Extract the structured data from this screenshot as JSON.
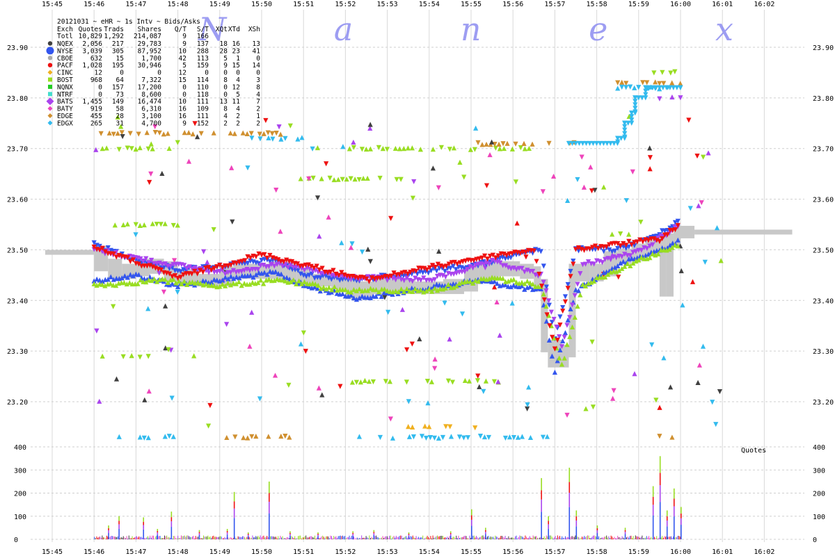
{
  "chart_data": {
    "type": "scatter",
    "title": "20121031 ~ eHR ~ 1s Intv ~ Bids/Asks",
    "watermark": "N a n e x",
    "x_ticks": [
      "15:45",
      "15:46",
      "15:47",
      "15:48",
      "15:49",
      "15:50",
      "15:51",
      "15:52",
      "15:53",
      "15:54",
      "15:55",
      "15:56",
      "15:57",
      "15:58",
      "15:59",
      "16:00",
      "16:01",
      "16:02"
    ],
    "price_axis": {
      "ylim": [
        23.12,
        23.93
      ],
      "ticks": [
        "23.90",
        "23.80",
        "23.70",
        "23.60",
        "23.50",
        "23.40",
        "23.30",
        "23.20"
      ],
      "tick_values": [
        23.9,
        23.8,
        23.7,
        23.6,
        23.5,
        23.4,
        23.3,
        23.2
      ]
    },
    "volume_axis": {
      "label": "Quotes",
      "ylim": [
        0,
        400
      ],
      "ticks": [
        "400",
        "300",
        "200",
        "100",
        "0"
      ],
      "tick_values": [
        400,
        300,
        200,
        100,
        0
      ]
    },
    "legend": {
      "header": [
        "Exch",
        "Quotes",
        "Trads",
        "Shares",
        "Q/T",
        "S/T",
        "XQt",
        "XTd",
        "XSh"
      ],
      "total": [
        "Totl",
        "10,829",
        "1,292",
        "214,087",
        "9",
        "166",
        "",
        "",
        ""
      ],
      "rows": [
        {
          "exch": "NQEX",
          "quotes": "2,056",
          "trads": "217",
          "shares": "29,783",
          "qt": "9",
          "st": "137",
          "xqt": "18",
          "xtd": "16",
          "xsh": "13",
          "color": "#404040",
          "marker": "circle"
        },
        {
          "exch": "NYSE",
          "quotes": "3,039",
          "trads": "305",
          "shares": "87,952",
          "qt": "10",
          "st": "288",
          "xqt": "28",
          "xtd": "23",
          "xsh": "41",
          "color": "#3355ee",
          "marker": "bigcircle"
        },
        {
          "exch": "CBOE",
          "quotes": "632",
          "trads": "15",
          "shares": "1,700",
          "qt": "42",
          "st": "113",
          "xqt": "5",
          "xtd": "1",
          "xsh": "0",
          "color": "#aaaaaa",
          "marker": "circle"
        },
        {
          "exch": "PACF",
          "quotes": "1,028",
          "trads": "195",
          "shares": "30,946",
          "qt": "5",
          "st": "159",
          "xqt": "9",
          "xtd": "15",
          "xsh": "14",
          "color": "#ee1111",
          "marker": "circle"
        },
        {
          "exch": "CINC",
          "quotes": "12",
          "trads": "0",
          "shares": "0",
          "qt": "12",
          "st": "0",
          "xqt": "0",
          "xtd": "0",
          "xsh": "0",
          "color": "#f0b020",
          "marker": "diamond"
        },
        {
          "exch": "BOST",
          "quotes": "968",
          "trads": "64",
          "shares": "7,322",
          "qt": "15",
          "st": "114",
          "xqt": "8",
          "xtd": "4",
          "xsh": "3",
          "color": "#99dd22",
          "marker": "square"
        },
        {
          "exch": "NQNX",
          "quotes": "0",
          "trads": "157",
          "shares": "17,200",
          "qt": "0",
          "st": "110",
          "xqt": "0",
          "xtd": "12",
          "xsh": "8",
          "color": "#22cc22",
          "marker": "square"
        },
        {
          "exch": "NTRF",
          "quotes": "0",
          "trads": "73",
          "shares": "8,600",
          "qt": "0",
          "st": "118",
          "xqt": "0",
          "xtd": "5",
          "xsh": "4",
          "color": "#44ddcc",
          "marker": "square"
        },
        {
          "exch": "BATS",
          "quotes": "1,455",
          "trads": "149",
          "shares": "16,474",
          "qt": "10",
          "st": "111",
          "xqt": "13",
          "xtd": "11",
          "xsh": "7",
          "color": "#aa44ee",
          "marker": "bigdiamond"
        },
        {
          "exch": "BATY",
          "quotes": "919",
          "trads": "58",
          "shares": "6,310",
          "qt": "16",
          "st": "109",
          "xqt": "8",
          "xtd": "4",
          "xsh": "2",
          "color": "#ee44bb",
          "marker": "diamond"
        },
        {
          "exch": "EDGE",
          "quotes": "455",
          "trads": "28",
          "shares": "3,100",
          "qt": "16",
          "st": "111",
          "xqt": "4",
          "xtd": "2",
          "xsh": "1",
          "color": "#d09030",
          "marker": "diamond"
        },
        {
          "exch": "EDGX",
          "quotes": "265",
          "trads": "31",
          "shares": "4,700",
          "qt": "9",
          "st": "152",
          "xqt": "2",
          "xtd": "2",
          "xsh": "2",
          "color": "#33bbee",
          "marker": "diamond"
        }
      ]
    },
    "nbbo_midpoint_path": [
      [
        "15:44:50",
        23.495
      ],
      [
        "15:46:00",
        23.495
      ],
      [
        "15:46:20",
        23.47
      ],
      [
        "15:46:40",
        23.455
      ],
      [
        "15:47:00",
        23.46
      ],
      [
        "15:47:20",
        23.47
      ],
      [
        "15:47:40",
        23.465
      ],
      [
        "15:48:00",
        23.45
      ],
      [
        "15:48:30",
        23.44
      ],
      [
        "15:49:00",
        23.44
      ],
      [
        "15:49:20",
        23.455
      ],
      [
        "15:49:50",
        23.46
      ],
      [
        "15:50:10",
        23.455
      ],
      [
        "15:50:20",
        23.465
      ],
      [
        "15:50:50",
        23.45
      ],
      [
        "15:51:10",
        23.44
      ],
      [
        "15:51:40",
        23.44
      ],
      [
        "15:52:00",
        23.435
      ],
      [
        "15:52:20",
        23.415
      ],
      [
        "15:52:40",
        23.425
      ],
      [
        "15:53:00",
        23.43
      ],
      [
        "15:53:40",
        23.425
      ],
      [
        "15:54:20",
        23.425
      ],
      [
        "15:54:50",
        23.43
      ],
      [
        "15:55:10",
        23.455
      ],
      [
        "15:55:40",
        23.465
      ],
      [
        "15:56:10",
        23.46
      ],
      [
        "15:56:30",
        23.455
      ],
      [
        "15:56:40",
        23.43
      ],
      [
        "15:56:50",
        23.31
      ],
      [
        "15:57:10",
        23.28
      ],
      [
        "15:57:20",
        23.3
      ],
      [
        "15:57:30",
        23.46
      ],
      [
        "15:57:50",
        23.45
      ],
      [
        "15:58:10",
        23.46
      ],
      [
        "15:58:30",
        23.485
      ],
      [
        "15:58:50",
        23.49
      ],
      [
        "15:59:10",
        23.5
      ],
      [
        "15:59:30",
        23.515
      ],
      [
        "15:59:40",
        23.42
      ],
      [
        "15:59:50",
        23.52
      ],
      [
        "16:00:00",
        23.535
      ],
      [
        "16:00:20",
        23.535
      ],
      [
        "16:02:40",
        23.535
      ]
    ],
    "quote_bands": [
      {
        "exch": "NYSE",
        "side": "bid",
        "color": "#3355ee",
        "path": [
          [
            "15:46:00",
            23.44
          ],
          [
            "15:47:00",
            23.45
          ],
          [
            "15:48:00",
            23.43
          ],
          [
            "15:49:20",
            23.445
          ],
          [
            "15:50:20",
            23.455
          ],
          [
            "15:51:00",
            23.43
          ],
          [
            "15:52:20",
            23.405
          ],
          [
            "15:55:10",
            23.44
          ],
          [
            "15:56:40",
            23.42
          ],
          [
            "15:57:00",
            23.26
          ],
          [
            "15:57:30",
            23.42
          ],
          [
            "15:58:30",
            23.47
          ],
          [
            "15:59:30",
            23.5
          ],
          [
            "16:00:00",
            23.52
          ]
        ]
      },
      {
        "exch": "NYSE",
        "side": "ask",
        "color": "#3355ee",
        "path": [
          [
            "15:46:00",
            23.51
          ],
          [
            "15:47:00",
            23.48
          ],
          [
            "15:48:00",
            23.46
          ],
          [
            "15:49:20",
            23.47
          ],
          [
            "15:50:20",
            23.48
          ],
          [
            "15:51:00",
            23.45
          ],
          [
            "15:52:20",
            23.44
          ],
          [
            "15:55:10",
            23.47
          ],
          [
            "15:56:40",
            23.5
          ],
          [
            "15:57:00",
            23.32
          ],
          [
            "15:57:30",
            23.5
          ],
          [
            "15:58:30",
            23.5
          ],
          [
            "15:59:30",
            23.53
          ],
          [
            "16:00:00",
            23.56
          ]
        ]
      },
      {
        "exch": "BOST",
        "side": "bid",
        "color": "#99dd22",
        "path": [
          [
            "15:46:00",
            23.43
          ],
          [
            "15:47:30",
            23.44
          ],
          [
            "15:49:00",
            23.43
          ],
          [
            "15:50:30",
            23.44
          ],
          [
            "15:52:00",
            23.42
          ],
          [
            "15:54:00",
            23.42
          ],
          [
            "15:55:30",
            23.445
          ],
          [
            "15:56:40",
            23.43
          ],
          [
            "15:57:10",
            23.27
          ],
          [
            "15:57:40",
            23.43
          ],
          [
            "15:59:00",
            23.48
          ],
          [
            "16:00:00",
            23.51
          ]
        ]
      },
      {
        "exch": "BATS",
        "side": "ask",
        "color": "#aa44ee",
        "path": [
          [
            "15:46:00",
            23.5
          ],
          [
            "15:47:30",
            23.475
          ],
          [
            "15:49:00",
            23.455
          ],
          [
            "15:50:30",
            23.47
          ],
          [
            "15:52:00",
            23.445
          ],
          [
            "15:54:00",
            23.44
          ],
          [
            "15:55:30",
            23.475
          ],
          [
            "15:56:40",
            23.45
          ],
          [
            "15:57:10",
            23.31
          ],
          [
            "15:57:40",
            23.47
          ],
          [
            "15:59:00",
            23.495
          ],
          [
            "16:00:00",
            23.55
          ]
        ]
      },
      {
        "exch": "PACF",
        "side": "ask",
        "color": "#ee1111",
        "path": [
          [
            "15:46:00",
            23.505
          ],
          [
            "15:48:00",
            23.445
          ],
          [
            "15:50:00",
            23.49
          ],
          [
            "15:52:30",
            23.44
          ],
          [
            "15:55:00",
            23.48
          ],
          [
            "15:56:30",
            23.5
          ],
          [
            "15:57:00",
            23.3
          ],
          [
            "15:57:30",
            23.5
          ],
          [
            "15:59:30",
            23.52
          ],
          [
            "16:00:00",
            23.55
          ]
        ]
      }
    ],
    "sparse_quote_levels": [
      {
        "exch": "BOST",
        "color": "#99dd22",
        "price": 23.7,
        "from": "15:46:00",
        "to": "15:47:50"
      },
      {
        "exch": "EDGE",
        "color": "#d09030",
        "price": 23.73,
        "from": "15:46:10",
        "to": "15:50:50"
      },
      {
        "exch": "EDGX",
        "color": "#33bbee",
        "price": 23.72,
        "from": "15:49:40",
        "to": "15:51:00"
      },
      {
        "exch": "BOST",
        "color": "#99dd22",
        "price": 23.7,
        "from": "15:52:00",
        "to": "15:56:40"
      },
      {
        "exch": "EDGE",
        "color": "#d09030",
        "price": 23.71,
        "from": "15:55:10",
        "to": "15:57:40"
      },
      {
        "exch": "BOST",
        "color": "#99dd22",
        "price": 23.29,
        "from": "15:46:00",
        "to": "15:47:20"
      },
      {
        "exch": "BOST",
        "color": "#99dd22",
        "price": 23.24,
        "from": "15:52:10",
        "to": "15:55:50"
      },
      {
        "exch": "BOST",
        "color": "#99dd22",
        "price": 23.55,
        "from": "15:46:30",
        "to": "15:48:00"
      },
      {
        "exch": "BOST",
        "color": "#99dd22",
        "price": 23.64,
        "from": "15:50:50",
        "to": "15:53:20"
      },
      {
        "exch": "BOST",
        "color": "#99dd22",
        "price": 23.53,
        "from": "15:58:10",
        "to": "15:59:10"
      },
      {
        "exch": "EDGX",
        "color": "#33bbee",
        "price": 23.13,
        "from": "15:46:30",
        "to": "15:48:10"
      },
      {
        "exch": "EDGE",
        "color": "#d09030",
        "price": 23.13,
        "from": "15:49:10",
        "to": "15:50:40"
      },
      {
        "exch": "EDGX",
        "color": "#33bbee",
        "price": 23.13,
        "from": "15:52:20",
        "to": "15:56:50"
      },
      {
        "exch": "CINC",
        "color": "#f0b020",
        "price": 23.15,
        "from": "15:53:30",
        "to": "15:55:10"
      },
      {
        "exch": "EDGE",
        "color": "#d09030",
        "price": 23.13,
        "from": "15:59:30",
        "to": "16:00:00"
      },
      {
        "exch": "BOST",
        "color": "#99dd22",
        "price": 23.85,
        "from": "15:59:10",
        "to": "16:00:00"
      },
      {
        "exch": "EDGE",
        "color": "#d09030",
        "price": 23.83,
        "from": "15:58:30",
        "to": "16:00:00"
      },
      {
        "exch": "BATS",
        "color": "#aa44ee",
        "price": 23.8,
        "from": "15:59:30",
        "to": "16:00:00"
      },
      {
        "exch": "EDGX",
        "color": "#33bbee",
        "price": 23.82,
        "from": "15:58:30",
        "to": "15:59:50"
      }
    ],
    "edgx_step_path": [
      [
        "15:57:20",
        23.71
      ],
      [
        "15:58:30",
        23.72
      ],
      [
        "15:58:40",
        23.75
      ],
      [
        "15:58:50",
        23.77
      ],
      [
        "15:58:55",
        23.8
      ],
      [
        "15:59:10",
        23.82
      ],
      [
        "16:00:00",
        23.82
      ]
    ],
    "quote_volume_spikes": [
      [
        "15:46:20",
        60
      ],
      [
        "15:46:35",
        100
      ],
      [
        "15:47:10",
        95
      ],
      [
        "15:47:30",
        45
      ],
      [
        "15:47:50",
        120
      ],
      [
        "15:48:30",
        40
      ],
      [
        "15:49:10",
        45
      ],
      [
        "15:49:20",
        205
      ],
      [
        "15:49:40",
        30
      ],
      [
        "15:50:10",
        250
      ],
      [
        "15:50:40",
        35
      ],
      [
        "15:51:20",
        30
      ],
      [
        "15:52:10",
        35
      ],
      [
        "15:52:40",
        40
      ],
      [
        "15:53:30",
        30
      ],
      [
        "15:54:30",
        35
      ],
      [
        "15:55:00",
        130
      ],
      [
        "15:55:20",
        50
      ],
      [
        "15:56:40",
        265
      ],
      [
        "15:56:50",
        100
      ],
      [
        "15:57:20",
        310
      ],
      [
        "15:57:30",
        125
      ],
      [
        "15:58:00",
        60
      ],
      [
        "15:58:40",
        50
      ],
      [
        "15:59:20",
        230
      ],
      [
        "15:59:30",
        360
      ],
      [
        "15:59:40",
        125
      ],
      [
        "15:59:50",
        220
      ],
      [
        "16:00:00",
        140
      ]
    ]
  }
}
